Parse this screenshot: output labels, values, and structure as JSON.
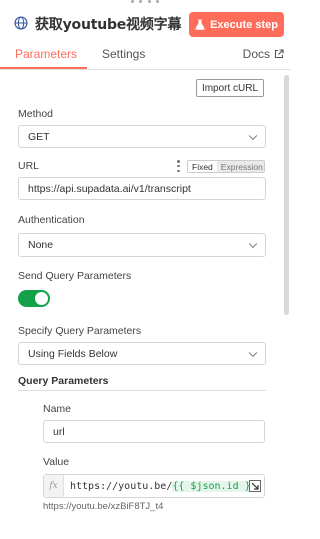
{
  "header": {
    "title": "获取youtube视频字幕",
    "execute_label": "Execute step"
  },
  "tabs": [
    {
      "label": "Parameters",
      "active": true
    },
    {
      "label": "Settings",
      "active": false
    }
  ],
  "docs_label": "Docs",
  "import_curl_label": "Import cURL",
  "method": {
    "label": "Method",
    "value": "GET"
  },
  "url": {
    "label": "URL",
    "value": "https://api.supadata.ai/v1/transcript",
    "mode_fixed": "Fixed",
    "mode_expression": "Expression"
  },
  "authentication": {
    "label": "Authentication",
    "value": "None"
  },
  "send_query": {
    "label": "Send Query Parameters",
    "enabled": true
  },
  "specify_query": {
    "label": "Specify Query Parameters",
    "value": "Using Fields Below"
  },
  "query_params": {
    "section_label": "Query Parameters",
    "name_label": "Name",
    "name_value": "url",
    "value_label": "Value",
    "fx_label": "fx",
    "value_prefix": "https://youtu.be/",
    "value_expression": "{{ $json.id }}",
    "resolved_value": "https://youtu.be/xzBiF8TJ_t4"
  },
  "colors": {
    "accent": "#ff6d5a",
    "toggle_on": "#13a24a"
  }
}
